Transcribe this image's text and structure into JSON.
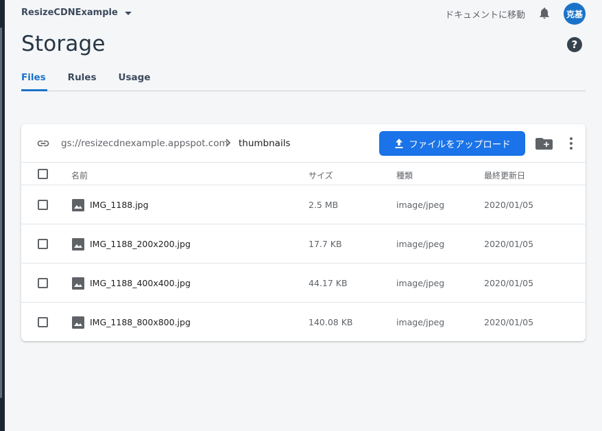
{
  "header": {
    "project_name": "ResizeCDNExample",
    "docs_link": "ドキュメントに移動",
    "avatar_text": "克基"
  },
  "page": {
    "title": "Storage",
    "help_glyph": "?"
  },
  "tabs": [
    {
      "label": "Files",
      "active": true
    },
    {
      "label": "Rules",
      "active": false
    },
    {
      "label": "Usage",
      "active": false
    }
  ],
  "browser": {
    "bucket_path": "gs://resizecdnexample.appspot.com",
    "current_folder": "thumbnails",
    "upload_label": "ファイルをアップロード",
    "columns": {
      "name": "名前",
      "size": "サイズ",
      "type": "種類",
      "modified": "最終更新日"
    },
    "files": [
      {
        "name": "IMG_1188.jpg",
        "size": "2.5 MB",
        "type": "image/jpeg",
        "modified": "2020/01/05"
      },
      {
        "name": "IMG_1188_200x200.jpg",
        "size": "17.7 KB",
        "type": "image/jpeg",
        "modified": "2020/01/05"
      },
      {
        "name": "IMG_1188_400x400.jpg",
        "size": "44.17 KB",
        "type": "image/jpeg",
        "modified": "2020/01/05"
      },
      {
        "name": "IMG_1188_800x800.jpg",
        "size": "140.08 KB",
        "type": "image/jpeg",
        "modified": "2020/01/05"
      }
    ]
  },
  "icons": {
    "notifications": "bell-icon",
    "link": "link-icon",
    "upload": "upload-icon",
    "new_folder": "add-folder-icon",
    "more": "more-vert-icon",
    "file": "image-icon"
  },
  "colors": {
    "accent": "#1a73e8",
    "tab_active": "#1a73c8",
    "avatar": "#1a73c8",
    "background": "#f5f6f8"
  }
}
